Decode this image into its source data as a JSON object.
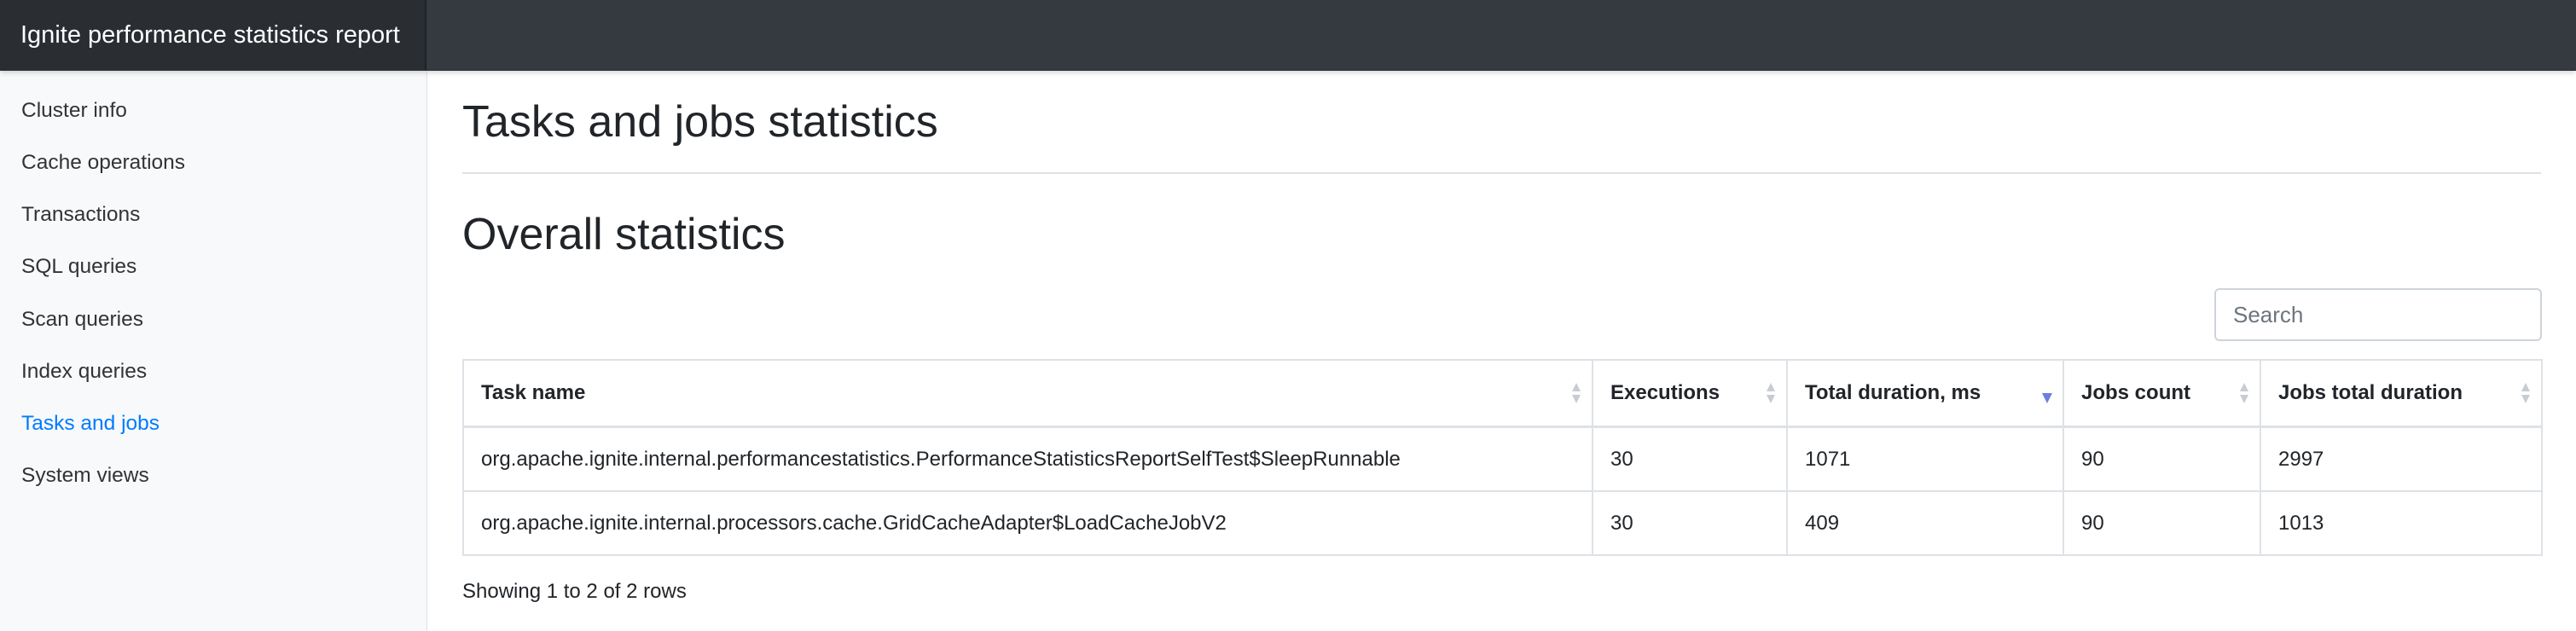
{
  "brand": {
    "title": "Ignite performance statistics report"
  },
  "sidebar": {
    "items": [
      {
        "label": "Cluster info",
        "active": false
      },
      {
        "label": "Cache operations",
        "active": false
      },
      {
        "label": "Transactions",
        "active": false
      },
      {
        "label": "SQL queries",
        "active": false
      },
      {
        "label": "Scan queries",
        "active": false
      },
      {
        "label": "Index queries",
        "active": false
      },
      {
        "label": "Tasks and jobs",
        "active": true
      },
      {
        "label": "System views",
        "active": false
      }
    ]
  },
  "main": {
    "page_title": "Tasks and jobs statistics",
    "section_title": "Overall statistics",
    "search": {
      "placeholder": "Search",
      "value": ""
    },
    "table": {
      "columns": [
        {
          "label": "Task name",
          "sort": "none"
        },
        {
          "label": "Executions",
          "sort": "none"
        },
        {
          "label": "Total duration, ms",
          "sort": "desc"
        },
        {
          "label": "Jobs count",
          "sort": "none"
        },
        {
          "label": "Jobs total duration",
          "sort": "none"
        }
      ],
      "rows": [
        [
          "org.apache.ignite.internal.performancestatistics.PerformanceStatisticsReportSelfTest$SleepRunnable",
          "30",
          "1071",
          "90",
          "2997"
        ],
        [
          "org.apache.ignite.internal.processors.cache.GridCacheAdapter$LoadCacheJobV2",
          "30",
          "409",
          "90",
          "1013"
        ]
      ]
    },
    "pagination_info": "Showing 1 to 2 of 2 rows"
  },
  "colors": {
    "navbar": "#343a40",
    "brand_bg": "#2a2e33",
    "sidebar_bg": "#f8f9fa",
    "active_link": "#007bff",
    "sort_active": "#6b7fe0",
    "sort_inactive": "#c8ccd0",
    "border": "#dee2e6"
  },
  "icons": {
    "sort_unsorted": "sort-both-icon",
    "sort_desc": "sort-desc-icon"
  }
}
